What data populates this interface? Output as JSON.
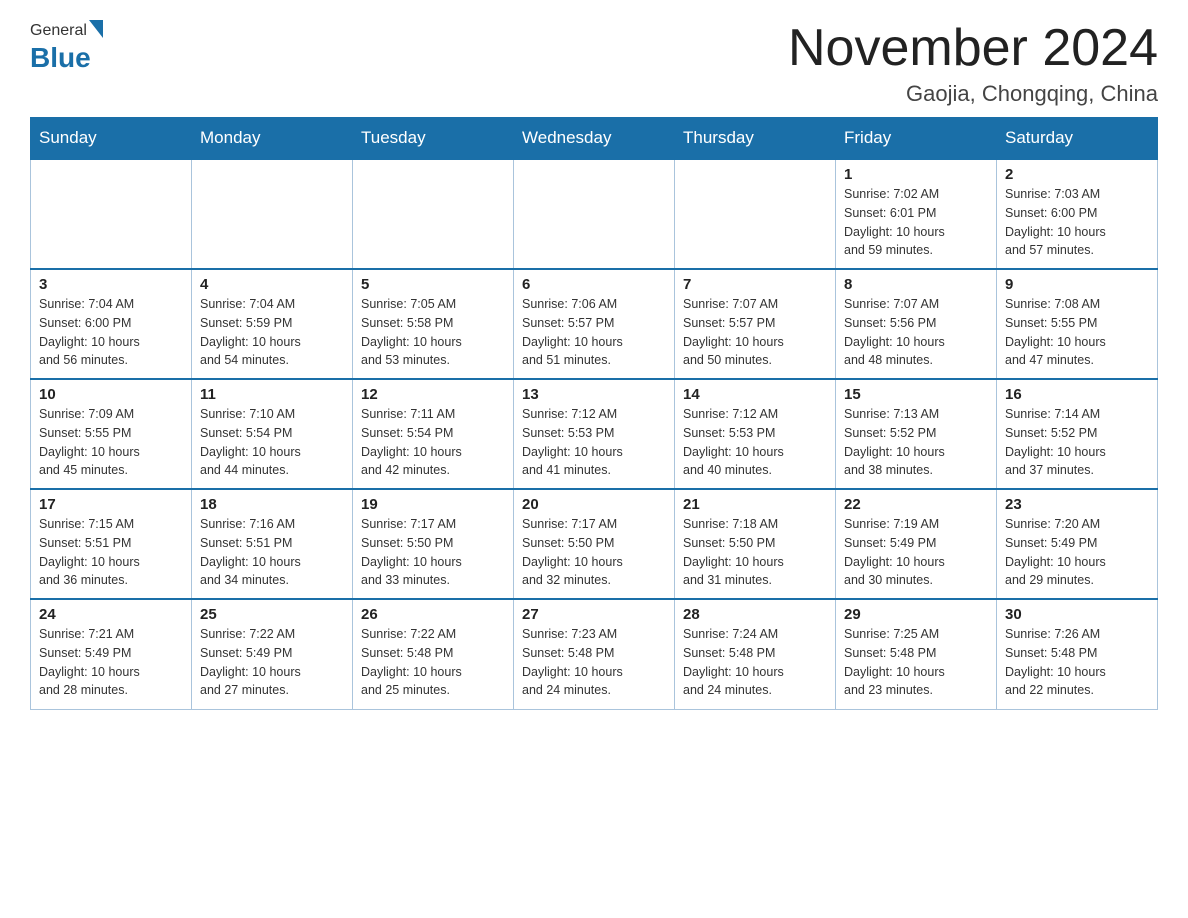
{
  "header": {
    "logo_general": "General",
    "logo_blue": "Blue",
    "month": "November 2024",
    "location": "Gaojia, Chongqing, China"
  },
  "weekdays": [
    "Sunday",
    "Monday",
    "Tuesday",
    "Wednesday",
    "Thursday",
    "Friday",
    "Saturday"
  ],
  "weeks": [
    [
      {
        "day": "",
        "info": ""
      },
      {
        "day": "",
        "info": ""
      },
      {
        "day": "",
        "info": ""
      },
      {
        "day": "",
        "info": ""
      },
      {
        "day": "",
        "info": ""
      },
      {
        "day": "1",
        "info": "Sunrise: 7:02 AM\nSunset: 6:01 PM\nDaylight: 10 hours\nand 59 minutes."
      },
      {
        "day": "2",
        "info": "Sunrise: 7:03 AM\nSunset: 6:00 PM\nDaylight: 10 hours\nand 57 minutes."
      }
    ],
    [
      {
        "day": "3",
        "info": "Sunrise: 7:04 AM\nSunset: 6:00 PM\nDaylight: 10 hours\nand 56 minutes."
      },
      {
        "day": "4",
        "info": "Sunrise: 7:04 AM\nSunset: 5:59 PM\nDaylight: 10 hours\nand 54 minutes."
      },
      {
        "day": "5",
        "info": "Sunrise: 7:05 AM\nSunset: 5:58 PM\nDaylight: 10 hours\nand 53 minutes."
      },
      {
        "day": "6",
        "info": "Sunrise: 7:06 AM\nSunset: 5:57 PM\nDaylight: 10 hours\nand 51 minutes."
      },
      {
        "day": "7",
        "info": "Sunrise: 7:07 AM\nSunset: 5:57 PM\nDaylight: 10 hours\nand 50 minutes."
      },
      {
        "day": "8",
        "info": "Sunrise: 7:07 AM\nSunset: 5:56 PM\nDaylight: 10 hours\nand 48 minutes."
      },
      {
        "day": "9",
        "info": "Sunrise: 7:08 AM\nSunset: 5:55 PM\nDaylight: 10 hours\nand 47 minutes."
      }
    ],
    [
      {
        "day": "10",
        "info": "Sunrise: 7:09 AM\nSunset: 5:55 PM\nDaylight: 10 hours\nand 45 minutes."
      },
      {
        "day": "11",
        "info": "Sunrise: 7:10 AM\nSunset: 5:54 PM\nDaylight: 10 hours\nand 44 minutes."
      },
      {
        "day": "12",
        "info": "Sunrise: 7:11 AM\nSunset: 5:54 PM\nDaylight: 10 hours\nand 42 minutes."
      },
      {
        "day": "13",
        "info": "Sunrise: 7:12 AM\nSunset: 5:53 PM\nDaylight: 10 hours\nand 41 minutes."
      },
      {
        "day": "14",
        "info": "Sunrise: 7:12 AM\nSunset: 5:53 PM\nDaylight: 10 hours\nand 40 minutes."
      },
      {
        "day": "15",
        "info": "Sunrise: 7:13 AM\nSunset: 5:52 PM\nDaylight: 10 hours\nand 38 minutes."
      },
      {
        "day": "16",
        "info": "Sunrise: 7:14 AM\nSunset: 5:52 PM\nDaylight: 10 hours\nand 37 minutes."
      }
    ],
    [
      {
        "day": "17",
        "info": "Sunrise: 7:15 AM\nSunset: 5:51 PM\nDaylight: 10 hours\nand 36 minutes."
      },
      {
        "day": "18",
        "info": "Sunrise: 7:16 AM\nSunset: 5:51 PM\nDaylight: 10 hours\nand 34 minutes."
      },
      {
        "day": "19",
        "info": "Sunrise: 7:17 AM\nSunset: 5:50 PM\nDaylight: 10 hours\nand 33 minutes."
      },
      {
        "day": "20",
        "info": "Sunrise: 7:17 AM\nSunset: 5:50 PM\nDaylight: 10 hours\nand 32 minutes."
      },
      {
        "day": "21",
        "info": "Sunrise: 7:18 AM\nSunset: 5:50 PM\nDaylight: 10 hours\nand 31 minutes."
      },
      {
        "day": "22",
        "info": "Sunrise: 7:19 AM\nSunset: 5:49 PM\nDaylight: 10 hours\nand 30 minutes."
      },
      {
        "day": "23",
        "info": "Sunrise: 7:20 AM\nSunset: 5:49 PM\nDaylight: 10 hours\nand 29 minutes."
      }
    ],
    [
      {
        "day": "24",
        "info": "Sunrise: 7:21 AM\nSunset: 5:49 PM\nDaylight: 10 hours\nand 28 minutes."
      },
      {
        "day": "25",
        "info": "Sunrise: 7:22 AM\nSunset: 5:49 PM\nDaylight: 10 hours\nand 27 minutes."
      },
      {
        "day": "26",
        "info": "Sunrise: 7:22 AM\nSunset: 5:48 PM\nDaylight: 10 hours\nand 25 minutes."
      },
      {
        "day": "27",
        "info": "Sunrise: 7:23 AM\nSunset: 5:48 PM\nDaylight: 10 hours\nand 24 minutes."
      },
      {
        "day": "28",
        "info": "Sunrise: 7:24 AM\nSunset: 5:48 PM\nDaylight: 10 hours\nand 24 minutes."
      },
      {
        "day": "29",
        "info": "Sunrise: 7:25 AM\nSunset: 5:48 PM\nDaylight: 10 hours\nand 23 minutes."
      },
      {
        "day": "30",
        "info": "Sunrise: 7:26 AM\nSunset: 5:48 PM\nDaylight: 10 hours\nand 22 minutes."
      }
    ]
  ]
}
